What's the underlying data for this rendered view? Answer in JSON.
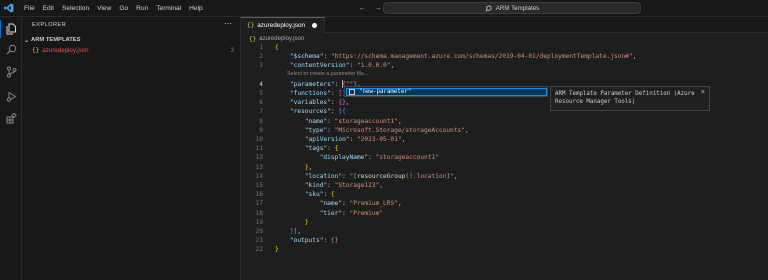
{
  "menu": [
    "File",
    "Edit",
    "Selection",
    "View",
    "Go",
    "Run",
    "Terminal",
    "Help"
  ],
  "command_center": "ARM Templates",
  "sidebar": {
    "title": "EXPLORER",
    "section": "ARM TEMPLATES",
    "file": {
      "name": "azuredeploy.json",
      "problems": "3"
    }
  },
  "tab": {
    "label": "azuredeploy.json"
  },
  "breadcrumb": "azuredeploy.json",
  "hint": "Select or create a parameter file...",
  "suggest": {
    "item": "\"new-parameter\""
  },
  "details": {
    "text": "ARM Template Parameter Definition (Azure Resource Manager Tools)"
  },
  "line_numbers": [
    "1",
    "2",
    "3",
    "4",
    "5",
    "6",
    "7",
    "8",
    "9",
    "10",
    "11",
    "12",
    "13",
    "14",
    "15",
    "16",
    "17",
    "18",
    "19",
    "20",
    "21",
    "22"
  ],
  "code": {
    "l2_key": "\"$schema\"",
    "l2_val": "\"https://schema.management.azure.com/schemas/2019-04-01/deploymentTemplate.json#\"",
    "l3_key": "\"contentVersion\"",
    "l3_val": "\"1.0.0.0\"",
    "l4_key": "\"parameters\"",
    "l5_key": "\"functions\"",
    "l6_key": "\"variables\"",
    "l7_key": "\"resources\"",
    "l8_key": "\"name\"",
    "l8_val": "\"storageaccount1\"",
    "l9_key": "\"type\"",
    "l9_val": "\"Microsoft.Storage/storageAccounts\"",
    "l10_key": "\"apiVersion\"",
    "l10_val": "\"2023-05-01\"",
    "l11_key": "\"tags\"",
    "l12_key": "\"displayName\"",
    "l12_val": "\"storageaccount1\"",
    "l14_key": "\"location\"",
    "l14_val_a": "\"[",
    "l14_fn": "resourceGroup",
    "l14_val_b": "().location]\"",
    "l15_key": "\"kind\"",
    "l15_val": "\"Storage123\"",
    "l16_key": "\"sku\"",
    "l17_key": "\"name\"",
    "l17_val": "\"Premium_LRS\"",
    "l18_key": "\"tier\"",
    "l18_val": "\"Premium\"",
    "l21_key": "\"outputs\""
  }
}
